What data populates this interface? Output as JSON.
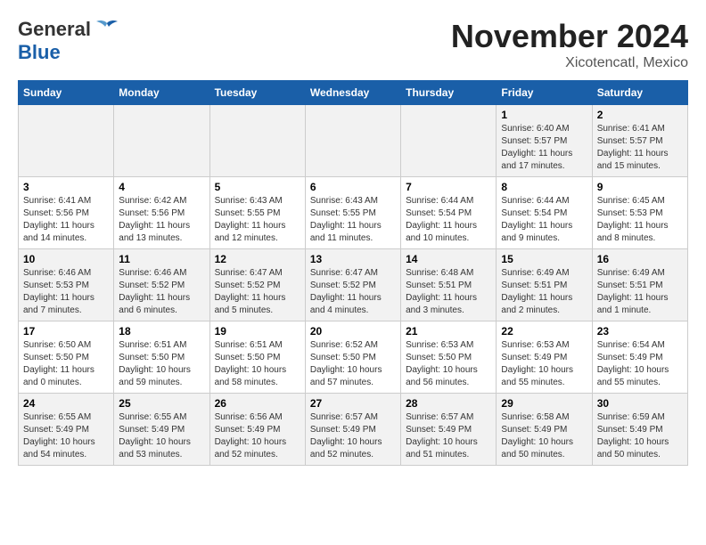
{
  "header": {
    "logo_general": "General",
    "logo_blue": "Blue",
    "title": "November 2024",
    "subtitle": "Xicotencatl, Mexico"
  },
  "days_of_week": [
    "Sunday",
    "Monday",
    "Tuesday",
    "Wednesday",
    "Thursday",
    "Friday",
    "Saturday"
  ],
  "weeks": [
    {
      "days": [
        {
          "num": "",
          "info": ""
        },
        {
          "num": "",
          "info": ""
        },
        {
          "num": "",
          "info": ""
        },
        {
          "num": "",
          "info": ""
        },
        {
          "num": "",
          "info": ""
        },
        {
          "num": "1",
          "info": "Sunrise: 6:40 AM\nSunset: 5:57 PM\nDaylight: 11 hours and 17 minutes."
        },
        {
          "num": "2",
          "info": "Sunrise: 6:41 AM\nSunset: 5:57 PM\nDaylight: 11 hours and 15 minutes."
        }
      ]
    },
    {
      "days": [
        {
          "num": "3",
          "info": "Sunrise: 6:41 AM\nSunset: 5:56 PM\nDaylight: 11 hours and 14 minutes."
        },
        {
          "num": "4",
          "info": "Sunrise: 6:42 AM\nSunset: 5:56 PM\nDaylight: 11 hours and 13 minutes."
        },
        {
          "num": "5",
          "info": "Sunrise: 6:43 AM\nSunset: 5:55 PM\nDaylight: 11 hours and 12 minutes."
        },
        {
          "num": "6",
          "info": "Sunrise: 6:43 AM\nSunset: 5:55 PM\nDaylight: 11 hours and 11 minutes."
        },
        {
          "num": "7",
          "info": "Sunrise: 6:44 AM\nSunset: 5:54 PM\nDaylight: 11 hours and 10 minutes."
        },
        {
          "num": "8",
          "info": "Sunrise: 6:44 AM\nSunset: 5:54 PM\nDaylight: 11 hours and 9 minutes."
        },
        {
          "num": "9",
          "info": "Sunrise: 6:45 AM\nSunset: 5:53 PM\nDaylight: 11 hours and 8 minutes."
        }
      ]
    },
    {
      "days": [
        {
          "num": "10",
          "info": "Sunrise: 6:46 AM\nSunset: 5:53 PM\nDaylight: 11 hours and 7 minutes."
        },
        {
          "num": "11",
          "info": "Sunrise: 6:46 AM\nSunset: 5:52 PM\nDaylight: 11 hours and 6 minutes."
        },
        {
          "num": "12",
          "info": "Sunrise: 6:47 AM\nSunset: 5:52 PM\nDaylight: 11 hours and 5 minutes."
        },
        {
          "num": "13",
          "info": "Sunrise: 6:47 AM\nSunset: 5:52 PM\nDaylight: 11 hours and 4 minutes."
        },
        {
          "num": "14",
          "info": "Sunrise: 6:48 AM\nSunset: 5:51 PM\nDaylight: 11 hours and 3 minutes."
        },
        {
          "num": "15",
          "info": "Sunrise: 6:49 AM\nSunset: 5:51 PM\nDaylight: 11 hours and 2 minutes."
        },
        {
          "num": "16",
          "info": "Sunrise: 6:49 AM\nSunset: 5:51 PM\nDaylight: 11 hours and 1 minute."
        }
      ]
    },
    {
      "days": [
        {
          "num": "17",
          "info": "Sunrise: 6:50 AM\nSunset: 5:50 PM\nDaylight: 11 hours and 0 minutes."
        },
        {
          "num": "18",
          "info": "Sunrise: 6:51 AM\nSunset: 5:50 PM\nDaylight: 10 hours and 59 minutes."
        },
        {
          "num": "19",
          "info": "Sunrise: 6:51 AM\nSunset: 5:50 PM\nDaylight: 10 hours and 58 minutes."
        },
        {
          "num": "20",
          "info": "Sunrise: 6:52 AM\nSunset: 5:50 PM\nDaylight: 10 hours and 57 minutes."
        },
        {
          "num": "21",
          "info": "Sunrise: 6:53 AM\nSunset: 5:50 PM\nDaylight: 10 hours and 56 minutes."
        },
        {
          "num": "22",
          "info": "Sunrise: 6:53 AM\nSunset: 5:49 PM\nDaylight: 10 hours and 55 minutes."
        },
        {
          "num": "23",
          "info": "Sunrise: 6:54 AM\nSunset: 5:49 PM\nDaylight: 10 hours and 55 minutes."
        }
      ]
    },
    {
      "days": [
        {
          "num": "24",
          "info": "Sunrise: 6:55 AM\nSunset: 5:49 PM\nDaylight: 10 hours and 54 minutes."
        },
        {
          "num": "25",
          "info": "Sunrise: 6:55 AM\nSunset: 5:49 PM\nDaylight: 10 hours and 53 minutes."
        },
        {
          "num": "26",
          "info": "Sunrise: 6:56 AM\nSunset: 5:49 PM\nDaylight: 10 hours and 52 minutes."
        },
        {
          "num": "27",
          "info": "Sunrise: 6:57 AM\nSunset: 5:49 PM\nDaylight: 10 hours and 52 minutes."
        },
        {
          "num": "28",
          "info": "Sunrise: 6:57 AM\nSunset: 5:49 PM\nDaylight: 10 hours and 51 minutes."
        },
        {
          "num": "29",
          "info": "Sunrise: 6:58 AM\nSunset: 5:49 PM\nDaylight: 10 hours and 50 minutes."
        },
        {
          "num": "30",
          "info": "Sunrise: 6:59 AM\nSunset: 5:49 PM\nDaylight: 10 hours and 50 minutes."
        }
      ]
    }
  ]
}
